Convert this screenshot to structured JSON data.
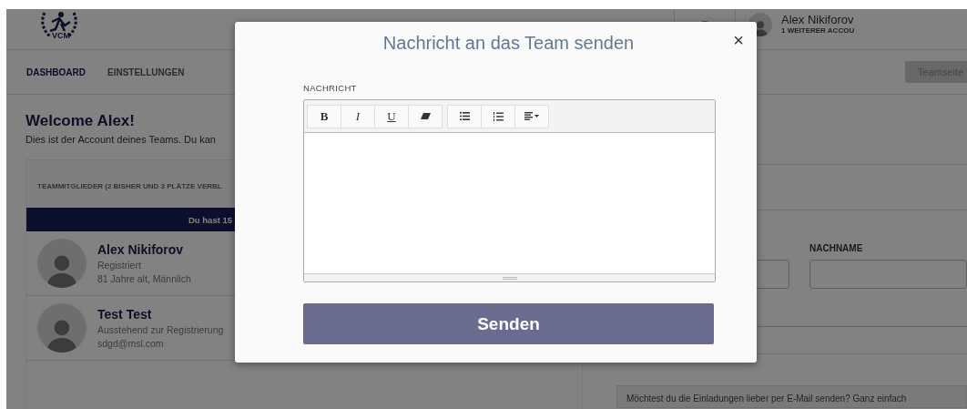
{
  "header": {
    "logo_text": "VCM",
    "user": {
      "name": "Alex Nikiforov",
      "subtitle": "1 WEITERER ACCOU"
    }
  },
  "nav": {
    "tabs": [
      {
        "label": "DASHBOARD",
        "selected": true
      },
      {
        "label": "EINSTELLUNGEN",
        "selected": false
      }
    ],
    "action": "Teamseite"
  },
  "welcome": {
    "title": "Welcome Alex!",
    "text": "Dies ist der Account deines Teams. Du kan"
  },
  "members": {
    "heading": "TEAMMITGLIEDER (2 BISHER UND 3 PLÄTZE VERBL",
    "banner": "Du hast 15",
    "items": [
      {
        "name": "Alex Nikiforov",
        "lines": [
          "Registriert",
          "81 Jahre alt, Männlich"
        ]
      },
      {
        "name": "Test Test",
        "lines": [
          "Ausstehend zur Registrierung",
          "sdgd@msl.com"
        ]
      }
    ]
  },
  "invite_form": {
    "field_label": "NACHNAME",
    "hint": "Möchtest du die Einladungen lieber per E-Mail senden? Ganz einfach"
  },
  "modal": {
    "title": "Nachricht an das Team senden",
    "close": "×",
    "label": "NACHRICHT",
    "toolbar": [
      [
        {
          "kind": "bold",
          "label": "B"
        },
        {
          "kind": "italic",
          "label": "I"
        },
        {
          "kind": "underline",
          "label": "U"
        },
        {
          "kind": "eraser"
        }
      ],
      [
        {
          "kind": "bullet-list"
        },
        {
          "kind": "numbered-list"
        },
        {
          "kind": "align"
        }
      ]
    ],
    "submit": "Senden"
  }
}
